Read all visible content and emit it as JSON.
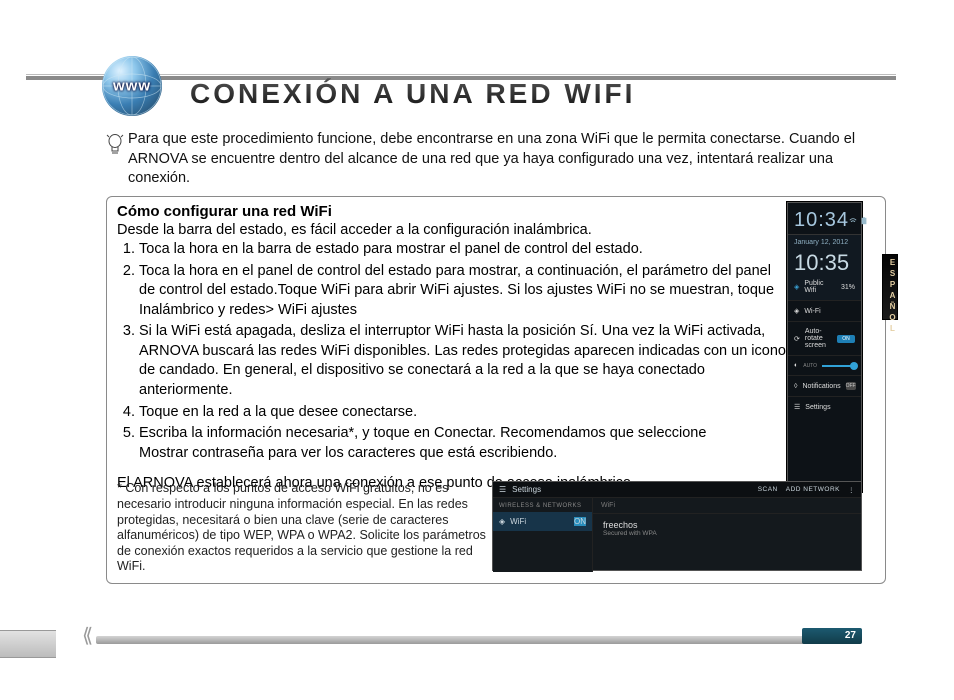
{
  "globe_label": "www",
  "title": "CONEXIÓN A UNA RED WIFI",
  "intro": "Para que este procedimiento funcione, debe encontrarse en una zona WiFi que le permita conectarse. Cuando el ARNOVA se encuentre dentro del alcance de una red que ya haya configurado una vez, intentará realizar una conexión.",
  "box": {
    "heading": "Cómo configurar una red WiFi",
    "lead": "Desde la barra del estado, es fácil acceder a la configuración inalámbrica.",
    "steps": [
      "Toca la hora en la barra de estado para mostrar el panel de control del estado.",
      "Toca la hora en el panel de control del estado para mostrar, a continuación, el parámetro del panel de control del estado.Toque WiFi para abrir WiFi ajustes. Si los ajustes WiFi no se muestran, toque Inalámbrico y redes> WiFi ajustes",
      "Si la WiFi está apagada, desliza el interruptor WiFi hasta la posición Sí. Una vez la WiFi activada, ARNOVA buscará las redes WiFi disponibles. Las redes protegidas aparecen indicadas con un icono de candado. En general, el dispositivo se conectará a la red a la que se haya conectado anteriormente.",
      "Toque en la red a la que desee conectarse.",
      "Escriba la información necesaria*, y toque en Conectar. Recomendamos que seleccione\nMostrar contraseña para ver los caracteres que está escribiendo."
    ],
    "conclusion": "El ARNOVA establecerá ahora una conexión a ese punto de acceso inalámbrico.",
    "footnote": "* Con respecto a los puntos de acceso WiFi gratuitos, no es necesario introducir ninguna información especial. En las redes protegidas, necesitará o bien una clave (serie de caracteres alfanuméricos) de tipo WEP, WPA o WPA2.  Solicite los parámetros de conexión exactos requeridos a la servicio que gestione la red WiFi."
  },
  "screenshot_status_panel": {
    "time_small": "10:34",
    "date": "January 12, 2012",
    "time_big": "10:35",
    "public_row": {
      "label": "Public Wifi",
      "signal": "31%"
    },
    "items": [
      {
        "icon": "wifi-icon",
        "label": "Wi-Fi",
        "toggle": null
      },
      {
        "icon": "rotate-icon",
        "label": "Auto-rotate screen",
        "toggle": "ON"
      },
      {
        "icon": "brightness-icon",
        "label": "AUTO",
        "toggle": "slider"
      },
      {
        "icon": "bell-icon",
        "label": "Notifications",
        "toggle": "OFF"
      },
      {
        "icon": "sliders-icon",
        "label": "Settings",
        "toggle": null
      }
    ]
  },
  "screenshot_wifi_settings": {
    "header_label": "Settings",
    "header_actions": [
      "SCAN",
      "ADD NETWORK"
    ],
    "side_category": "WIRELESS & NETWORKS",
    "side_item": {
      "label": "WiFi",
      "toggle": "ON"
    },
    "main_header": "WiFi",
    "network": {
      "name": "freechos",
      "security": "Secured with WPA"
    }
  },
  "lang_tab": "ESPAÑOL",
  "page_number": "27"
}
